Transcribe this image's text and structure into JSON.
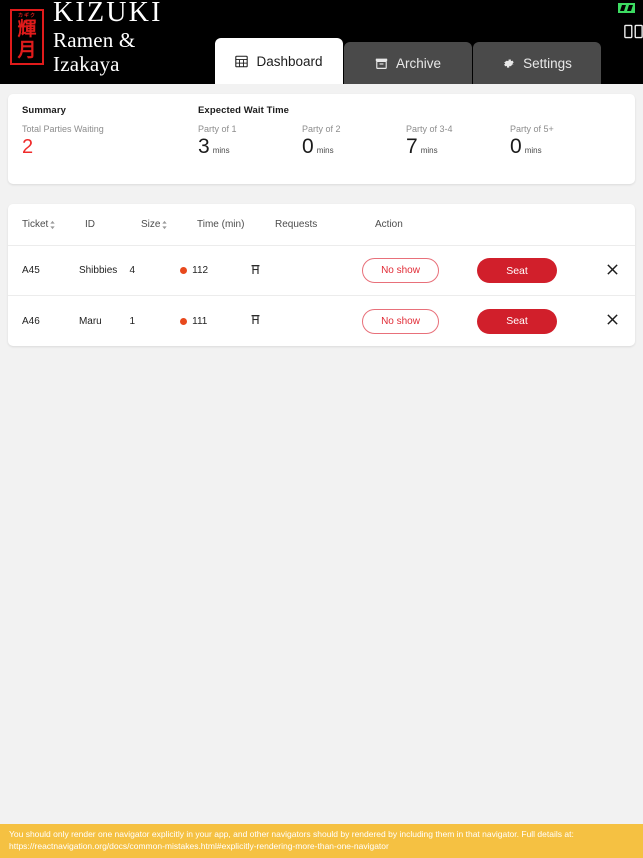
{
  "header": {
    "brand": {
      "mark_top_small": "カギク",
      "mark_kanji_1": "輝",
      "mark_kanji_2": "月",
      "name_line1": "KIZUKI",
      "name_line2": "Ramen & Izakaya"
    },
    "tabs": [
      {
        "label": "Dashboard",
        "icon": "grid-icon",
        "active": true
      },
      {
        "label": "Archive",
        "icon": "archive-box-icon",
        "active": false
      },
      {
        "label": "Settings",
        "icon": "gear-icon",
        "active": false
      }
    ],
    "right_control_icon": "split-view-icon",
    "status_indicator": "battery-charging-icon"
  },
  "summary": {
    "title": "Summary",
    "total_label": "Total Parties Waiting",
    "total_value": "2",
    "total_value_color": "#ef2b2b",
    "wait_title": "Expected Wait Time",
    "wait_items": [
      {
        "label": "Party of 1",
        "value": "3",
        "unit": "mins"
      },
      {
        "label": "Party of 2",
        "value": "0",
        "unit": "mins"
      },
      {
        "label": "Party of 3-4",
        "value": "7",
        "unit": "mins"
      },
      {
        "label": "Party of 5+",
        "value": "0",
        "unit": "mins"
      }
    ]
  },
  "table": {
    "columns": {
      "ticket": "Ticket",
      "id": "ID",
      "size": "Size",
      "time": "Time (min)",
      "requests": "Requests",
      "action": "Action"
    },
    "rows": [
      {
        "ticket": "A45",
        "id": "Shibbies",
        "size": "4",
        "time": "112",
        "time_dot_color": "#e8491d",
        "request_icon": "stool-icon",
        "no_show_label": "No show",
        "seat_label": "Seat",
        "close_icon": "close-icon"
      },
      {
        "ticket": "A46",
        "id": "Maru",
        "size": "1",
        "time": "111",
        "time_dot_color": "#e8491d",
        "request_icon": "stool-icon",
        "no_show_label": "No show",
        "seat_label": "Seat",
        "close_icon": "close-icon"
      }
    ]
  },
  "warning": {
    "text": "You should only render one navigator explicitly in your app, and other navigators should by rendered by including them in that navigator. Full details at: https://reactnavigation.org/docs/common-mistakes.html#explicitly-rendering-more-than-one-navigator",
    "background": "#f5c142"
  }
}
